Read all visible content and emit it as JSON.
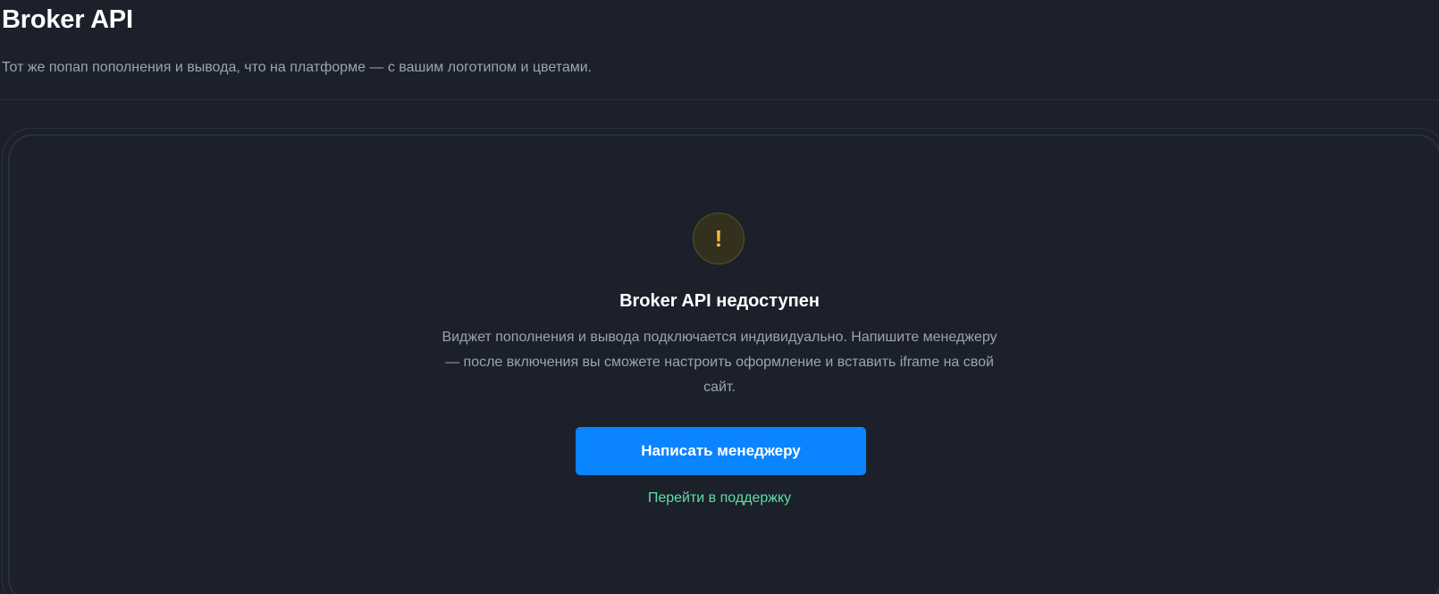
{
  "header": {
    "title": "Broker API",
    "subtitle": "Тот же попап пополнения и вывода, что на платформе — с вашим логотипом и цветами."
  },
  "empty_state": {
    "icon": "exclamation-icon",
    "icon_glyph": "!",
    "title": "Broker API недоступен",
    "description": "Виджет пополнения и вывода подключается индивидуально. Напишите менеджеру — после включения вы сможете настроить оформление и вставить iframe на свой сайт.",
    "primary_button_label": "Написать менеджеру",
    "support_link_label": "Перейти в поддержку"
  },
  "colors": {
    "background": "#1c202b",
    "accent": "#0a84ff",
    "warning": "#f5b93e",
    "link": "#5fe0a0"
  }
}
